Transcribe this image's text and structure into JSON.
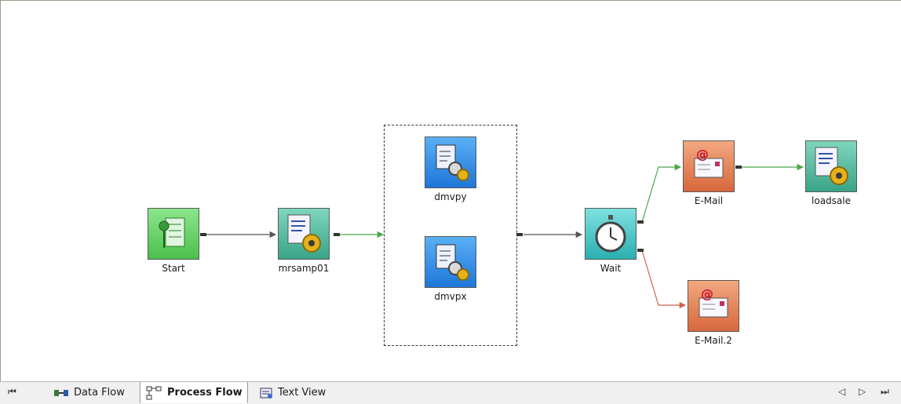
{
  "diagram": {
    "nodes": [
      {
        "id": "start",
        "label": "Start",
        "kind": "start",
        "color": "#6fd36f"
      },
      {
        "id": "mrsamp01",
        "label": "mrsamp01",
        "kind": "job",
        "color": "#58bfa4"
      },
      {
        "id": "dmvpy",
        "label": "dmvpy",
        "kind": "job-blue",
        "color": "#2a8ee8"
      },
      {
        "id": "dmvpx",
        "label": "dmvpx",
        "kind": "job-blue",
        "color": "#2a8ee8"
      },
      {
        "id": "wait",
        "label": "Wait",
        "kind": "wait",
        "color": "#46c6c6"
      },
      {
        "id": "email",
        "label": "E-Mail",
        "kind": "email",
        "color": "#e88a5c"
      },
      {
        "id": "loadsale",
        "label": "loadsale",
        "kind": "job",
        "color": "#58bfa4"
      },
      {
        "id": "email2",
        "label": "E-Mail.2",
        "kind": "email",
        "color": "#e88a5c"
      }
    ],
    "edges": [
      {
        "from": "start",
        "to": "mrsamp01",
        "color": "#555555"
      },
      {
        "from": "mrsamp01",
        "to": "group",
        "color": "#4aa84a"
      },
      {
        "from": "group",
        "to": "wait",
        "color": "#555555"
      },
      {
        "from": "wait",
        "to": "email",
        "color": "#4aa84a"
      },
      {
        "from": "email",
        "to": "loadsale",
        "color": "#4aa84a"
      },
      {
        "from": "wait",
        "to": "email2",
        "color": "#d0624a"
      }
    ]
  },
  "tabs": [
    {
      "label": "Data Flow",
      "icon": "data-flow-icon",
      "active": false
    },
    {
      "label": "Process Flow",
      "icon": "process-flow-icon",
      "active": true
    },
    {
      "label": "Text View",
      "icon": "text-view-icon",
      "active": false
    }
  ],
  "nav": {
    "first": "⏮",
    "prev": "◁",
    "next": "▷",
    "last": "⏭"
  }
}
